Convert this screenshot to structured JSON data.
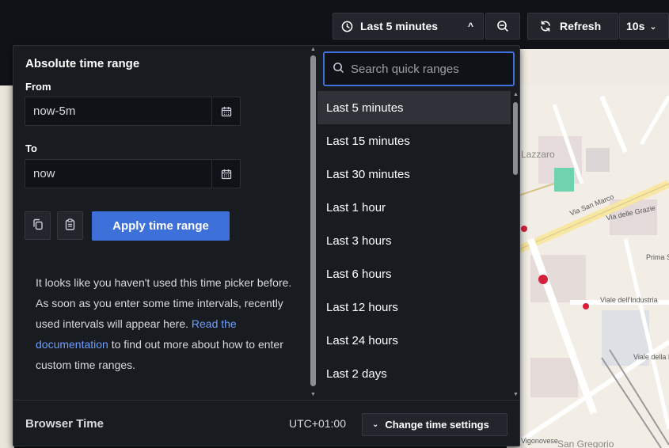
{
  "toolbar": {
    "time_range_label": "Last 5 minutes",
    "refresh_label": "Refresh",
    "interval_label": "10s"
  },
  "absolute": {
    "title": "Absolute time range",
    "from_label": "From",
    "from_value": "now-5m",
    "to_label": "To",
    "to_value": "now",
    "apply_label": "Apply time range"
  },
  "info": {
    "text": "It looks like you haven't used this time picker before. As soon as you enter some time intervals, recently used intervals will appear here.",
    "link": "Read the documentation",
    "tail": " to find out more about how to enter custom time ranges."
  },
  "search": {
    "placeholder": "Search quick ranges"
  },
  "ranges": [
    "Last 5 minutes",
    "Last 15 minutes",
    "Last 30 minutes",
    "Last 1 hour",
    "Last 3 hours",
    "Last 6 hours",
    "Last 12 hours",
    "Last 24 hours",
    "Last 2 days"
  ],
  "selected_range": "Last 5 minutes",
  "footer": {
    "timezone": "Browser Time",
    "offset": "UTC+01:00",
    "change_label": "Change time settings"
  },
  "map": {
    "labels": [
      "Lazzaro",
      "Via San Marco",
      "Via delle Grazie",
      "Prima S",
      "Viale dell'Industria",
      "Viale della Nav",
      "San Gregorio",
      "Vigonovese"
    ]
  },
  "colors": {
    "accent": "#3d71d9",
    "link": "#6e9fff",
    "panel": "#181b1f",
    "background": "#111217"
  }
}
